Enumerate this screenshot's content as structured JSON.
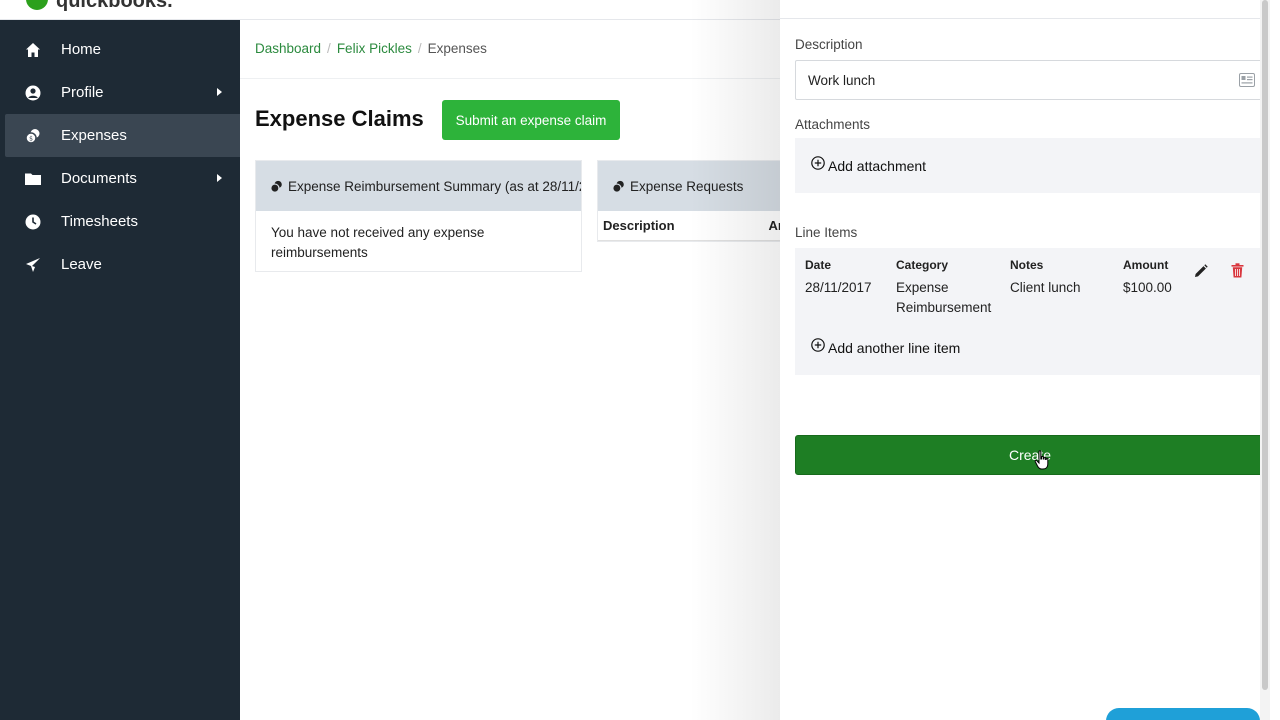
{
  "brand": {
    "name": "quickbooks."
  },
  "sidebar": {
    "items": [
      {
        "label": "Home",
        "icon": "home-icon",
        "has_submenu": false,
        "active": false
      },
      {
        "label": "Profile",
        "icon": "user-icon",
        "has_submenu": true,
        "active": false
      },
      {
        "label": "Expenses",
        "icon": "coins-icon",
        "has_submenu": false,
        "active": true
      },
      {
        "label": "Documents",
        "icon": "folder-icon",
        "has_submenu": true,
        "active": false
      },
      {
        "label": "Timesheets",
        "icon": "clock-icon",
        "has_submenu": false,
        "active": false
      },
      {
        "label": "Leave",
        "icon": "plane-icon",
        "has_submenu": false,
        "active": false
      }
    ]
  },
  "breadcrumb": {
    "dashboard": "Dashboard",
    "person": "Felix Pickles",
    "current": "Expenses"
  },
  "main": {
    "title": "Expense Claims",
    "submit_button": "Submit an expense claim",
    "summary_card": {
      "header": "Expense Reimbursement Summary (as at 28/11/2",
      "body": "You have not received any expense reimbursements"
    },
    "requests_card": {
      "header": "Expense Requests",
      "col_description": "Description",
      "col_amount": "Ar"
    }
  },
  "panel": {
    "description_label": "Description",
    "description_value": "Work lunch",
    "attachments_label": "Attachments",
    "add_attachment": "Add attachment",
    "line_items_label": "Line Items",
    "line_items": [
      {
        "date_header": "Date",
        "date": "28/11/2017",
        "category_header": "Category",
        "category": "Expense Reimbursement",
        "notes_header": "Notes",
        "notes": "Client lunch",
        "amount_header": "Amount",
        "amount": "$100.00"
      }
    ],
    "add_line_item": "Add another line item",
    "create_button": "Create"
  },
  "colors": {
    "accent": "#2db33a",
    "create": "#1e7e24",
    "sidebar": "#1e2a35",
    "link": "#2b8a3e",
    "delete": "#d9363e"
  }
}
